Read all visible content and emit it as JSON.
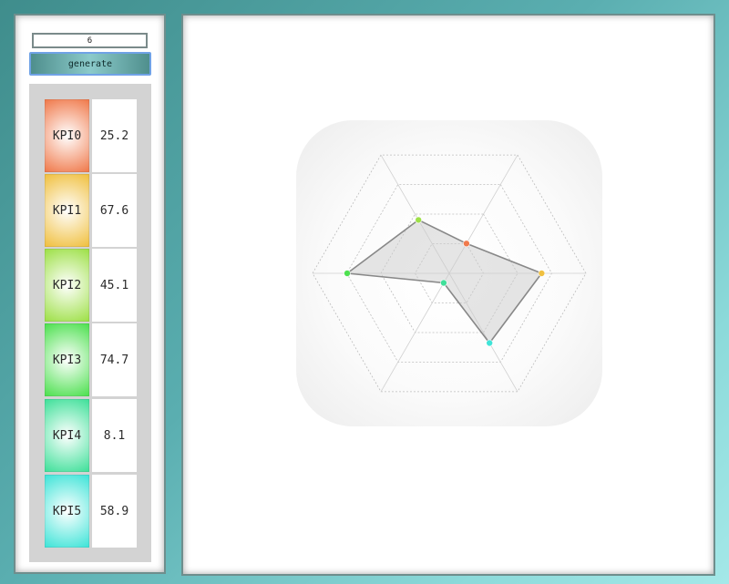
{
  "controls": {
    "count_value": "6",
    "generate_label": "generate"
  },
  "kpis": [
    {
      "label": "KPI0",
      "value": "25.2",
      "color": "#f07a4c"
    },
    {
      "label": "KPI1",
      "value": "67.6",
      "color": "#f0c040"
    },
    {
      "label": "KPI2",
      "value": "45.1",
      "color": "#9ee048"
    },
    {
      "label": "KPI3",
      "value": "74.7",
      "color": "#4ee050"
    },
    {
      "label": "KPI4",
      "value": "8.1",
      "color": "#40e09a"
    },
    {
      "label": "KPI5",
      "value": "58.9",
      "color": "#40e4d8"
    }
  ],
  "chart_data": {
    "type": "radar",
    "categories": [
      "KPI0",
      "KPI1",
      "KPI2",
      "KPI3",
      "KPI4",
      "KPI5"
    ],
    "values": [
      25.2,
      67.6,
      45.1,
      74.7,
      8.1,
      58.9
    ],
    "range": [
      0,
      100
    ],
    "rings": 4,
    "axis_order": [
      0,
      1,
      5,
      4,
      3,
      2
    ],
    "grid": true,
    "fill_color": "#cccccc",
    "line_color": "#888888"
  }
}
